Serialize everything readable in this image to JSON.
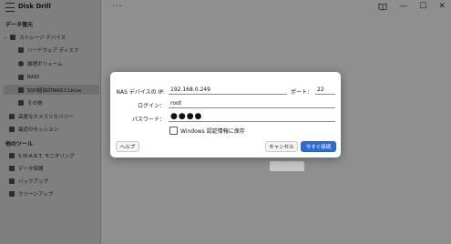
{
  "app": {
    "title": "Disk Drill",
    "more_label": "···"
  },
  "sidebar": {
    "sections": [
      {
        "label": "データ復元"
      },
      {
        "label": "他のツール"
      }
    ],
    "storage_group": "ストレージ デバイス",
    "items": [
      {
        "label": "ハードウェア ディスク",
        "icon": "hard-drive-icon"
      },
      {
        "label": "論理ボリューム",
        "icon": "volume-icon"
      },
      {
        "label": "RAID",
        "icon": "raid-icon"
      },
      {
        "label": "SSH経由のNASとLinux",
        "icon": "nas-icon"
      },
      {
        "label": "その他",
        "icon": "other-icon"
      },
      {
        "label": "高度なカメラリカバリー",
        "icon": "camera-icon"
      },
      {
        "label": "最近のセッション",
        "icon": "sessions-icon"
      },
      {
        "label": "S.M.A.R.T. モニタリング",
        "icon": "smart-icon"
      },
      {
        "label": "データ保護",
        "icon": "shield-icon"
      },
      {
        "label": "バックアップ",
        "icon": "backup-icon"
      },
      {
        "label": "クリーンアップ",
        "icon": "cleanup-icon"
      }
    ]
  },
  "dialog": {
    "nas_ip_label": "NAS デバイスの IP:",
    "nas_ip_value": "192.168.0.249",
    "port_label": "ポート：",
    "port_value": "22",
    "login_label": "ログイン：",
    "login_value": "root",
    "password_label": "パスワード：",
    "password_value": "●●●●",
    "save_checkbox_label": "Windows 認証情報に保存",
    "help_label": "ヘルプ",
    "cancel_label": "キャンセル",
    "connect_label": "今すぐ接続",
    "accent_color": "#2f6bd6"
  }
}
